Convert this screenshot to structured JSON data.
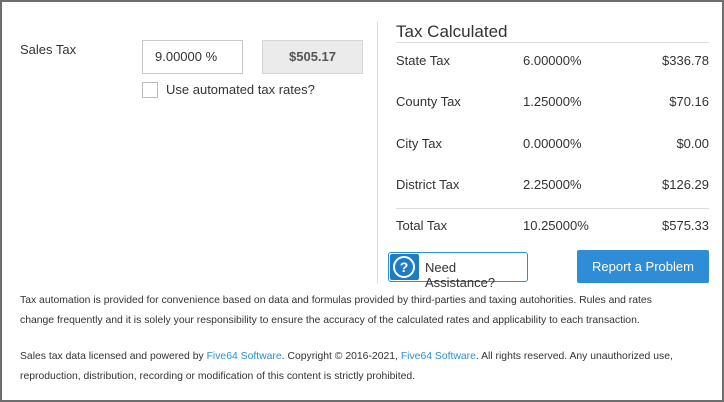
{
  "sales_tax": {
    "label": "Sales Tax",
    "rate_value": "9.00000 %",
    "amount": "$505.17",
    "automated_label": "Use automated tax rates?",
    "automated_checked": false
  },
  "calculated": {
    "title": "Tax Calculated",
    "rows": [
      {
        "name": "State Tax",
        "rate": "6.00000%",
        "amount": "$336.78"
      },
      {
        "name": "County Tax",
        "rate": "1.25000%",
        "amount": "$70.16"
      },
      {
        "name": "City Tax",
        "rate": "0.00000%",
        "amount": "$0.00"
      },
      {
        "name": "District Tax",
        "rate": "2.25000%",
        "amount": "$126.29"
      }
    ],
    "total": {
      "name": "Total Tax",
      "rate": "10.25000%",
      "amount": "$575.33"
    }
  },
  "buttons": {
    "assist_icon": "question-circle-icon",
    "assist_glyph": "?",
    "assist_label": "Need Assistance?",
    "report_label": "Report a Problem"
  },
  "disclaimer": {
    "line1": "Tax automation is provided for convenience based on data and formulas provided by third-parties and taxing autohorities. Rules and rates",
    "line2": "change frequently and it is solely your responsibility to ensure the accuracy of the calculated rates and applicability to each transaction."
  },
  "license": {
    "part1": "Sales tax data licensed and powered by ",
    "link1": "Five64 Software",
    "part2": ". Copyright © 2016-2021, ",
    "link2": "Five64 Software",
    "part3": ". All rights reserved. Any unauthorized use,",
    "line2": "reproduction, distribution, recording or modification of this content is strictly prohibited."
  },
  "colors": {
    "accent": "#2f8dd8",
    "link": "#2a8fd6",
    "border": "#6e6e6e"
  }
}
